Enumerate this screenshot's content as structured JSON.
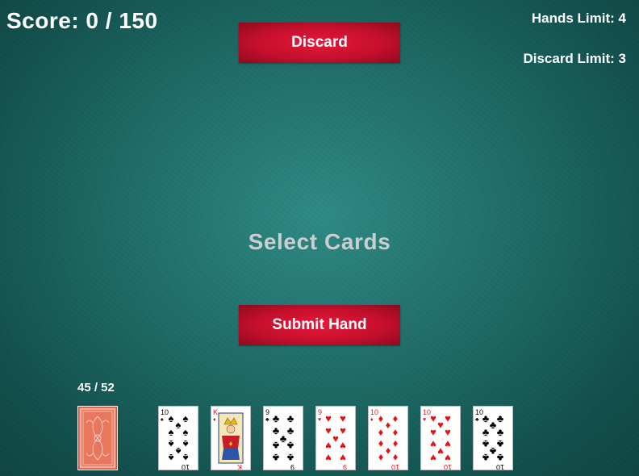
{
  "hud": {
    "score": "Score: 0 / 150",
    "hands_limit": "Hands Limit: 4",
    "discard_limit": "Discard Limit: 3"
  },
  "buttons": {
    "discard": "Discard",
    "submit": "Submit Hand"
  },
  "prompt": "Select Cards",
  "deck": {
    "count": "45 / 52"
  },
  "hand": [
    {
      "rank": "10",
      "suit": "spades",
      "color": "#000000"
    },
    {
      "rank": "K",
      "suit": "diamonds",
      "color": "#e2141b"
    },
    {
      "rank": "9",
      "suit": "clubs",
      "color": "#000000"
    },
    {
      "rank": "9",
      "suit": "hearts",
      "color": "#e2141b"
    },
    {
      "rank": "10",
      "suit": "diamonds",
      "color": "#e2141b"
    },
    {
      "rank": "10",
      "suit": "hearts",
      "color": "#e2141b"
    },
    {
      "rank": "10",
      "suit": "clubs",
      "color": "#000000"
    }
  ]
}
